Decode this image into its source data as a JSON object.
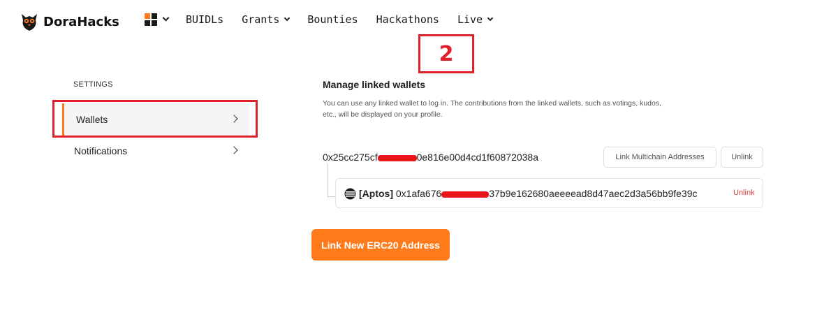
{
  "header": {
    "logo_text": "DoraHacks",
    "nav": [
      {
        "label": "BUIDLs"
      },
      {
        "label": "Grants"
      },
      {
        "label": "Bounties"
      },
      {
        "label": "Hackathons"
      },
      {
        "label": "Live"
      }
    ]
  },
  "annotations": {
    "step_number": "2"
  },
  "sidebar": {
    "section_label": "SETTINGS",
    "items": [
      {
        "label": "Wallets",
        "active": true
      },
      {
        "label": "Notifications",
        "active": false
      }
    ]
  },
  "main": {
    "title": "Manage linked wallets",
    "description": "You can use any linked wallet to log in. The contributions from the linked wallets, such as votings, kudos, etc., will be displayed on your profile.",
    "wallet": {
      "address_start": "0x25cc275cf",
      "address_end": "0e816e00d4cd1f60872038a",
      "link_multichain_label": "Link Multichain Addresses",
      "unlink_label": "Unlink",
      "linked": {
        "chain_tag": "[Aptos]",
        "address_start": "0x1afa676",
        "address_end": "37b9e162680aeeeead8d47aec2d3a56bb9fe39c",
        "unlink_label": "Unlink"
      }
    },
    "link_new_label": "Link New ERC20 Address"
  },
  "colors": {
    "accent": "#ff7a1a",
    "annotation_red": "#e0202b",
    "unlink_red": "#d94040"
  }
}
